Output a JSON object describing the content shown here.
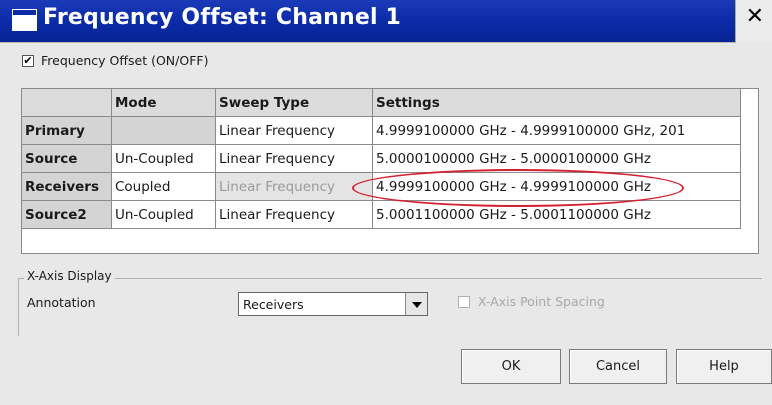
{
  "dialog": {
    "title": "Frequency Offset: Channel 1",
    "close_glyph": "✕"
  },
  "offset_toggle": {
    "label": "Frequency Offset (ON/OFF)",
    "checked": true,
    "check_glyph": "✔"
  },
  "grid": {
    "headers": [
      "",
      "Mode",
      "Sweep Type",
      "Settings"
    ],
    "rows": [
      {
        "name": "Primary",
        "mode": "",
        "sweep_type": "Linear Frequency",
        "settings": "4.9999100000 GHz - 4.9999100000 GHz, 201"
      },
      {
        "name": "Source",
        "mode": "Un-Coupled",
        "sweep_type": "Linear Frequency",
        "settings": "5.0000100000 GHz - 5.0000100000 GHz"
      },
      {
        "name": "Receivers",
        "mode": "Coupled",
        "sweep_type": "Linear Frequency",
        "settings": "4.9999100000 GHz - 4.9999100000 GHz",
        "sweep_disabled": true,
        "highlighted": true
      },
      {
        "name": "Source2",
        "mode": "Un-Coupled",
        "sweep_type": "Linear Frequency",
        "settings": "5.0001100000 GHz - 5.0001100000 GHz"
      }
    ]
  },
  "xaxis": {
    "group_title": "X-Axis Display",
    "annotation_label": "Annotation",
    "annotation_value": "Receivers",
    "point_spacing_label": "X-Axis Point Spacing",
    "point_spacing_checked": false,
    "point_spacing_enabled": false
  },
  "buttons": {
    "ok": "OK",
    "cancel": "Cancel",
    "help": "Help"
  },
  "colors": {
    "titlebar": "#0a2aa6",
    "highlight_ellipse": "#d42030",
    "disabled_text": "#9a9a9a"
  }
}
